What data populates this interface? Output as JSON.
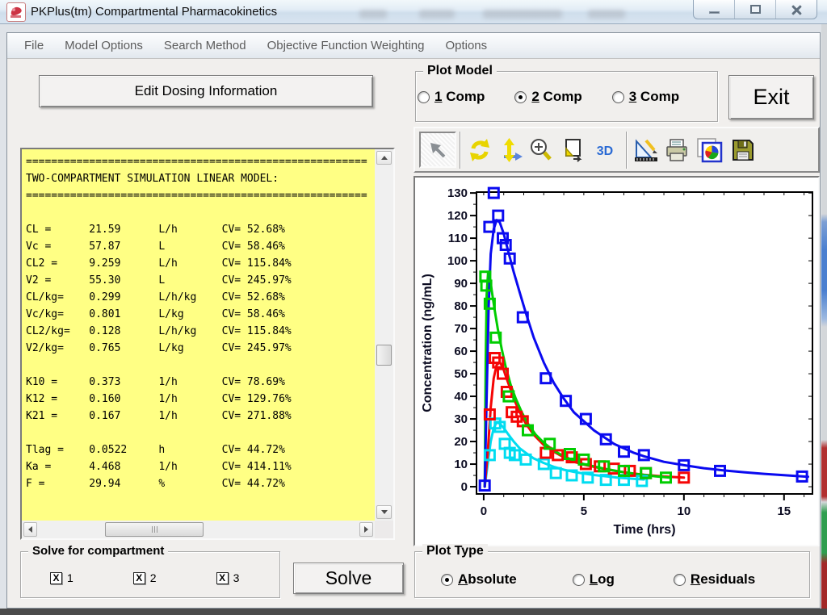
{
  "window": {
    "title": "PKPlus(tm) Compartmental Pharmacokinetics",
    "controls": {
      "minimize": "minimize",
      "maximize": "maximize",
      "close": "close"
    }
  },
  "menu": {
    "items": [
      "File",
      "Model Options",
      "Search Method",
      "Objective Function Weighting",
      "Options"
    ]
  },
  "left_panel": {
    "edit_dosing_button": "Edit Dosing Information",
    "results_lines": [
      "======================================================",
      "TWO-COMPARTMENT SIMULATION LINEAR MODEL:",
      "======================================================",
      "",
      "CL =      21.59      L/h       CV= 52.68%",
      "Vc =      57.87      L         CV= 58.46%",
      "CL2 =     9.259      L/h       CV= 115.84%",
      "V2 =      55.30      L         CV= 245.97%",
      "CL/kg=    0.299      L/h/kg    CV= 52.68%",
      "Vc/kg=    0.801      L/kg      CV= 58.46%",
      "CL2/kg=   0.128      L/h/kg    CV= 115.84%",
      "V2/kg=    0.765      L/kg      CV= 245.97%",
      "",
      "K10 =     0.373      1/h       CV= 78.69%",
      "K12 =     0.160      1/h       CV= 129.76%",
      "K21 =     0.167      1/h       CV= 271.88%",
      "",
      "Tlag =    0.0522     h         CV= 44.72%",
      "Ka =      4.468      1/h       CV= 414.11%",
      "F =       29.94      %         CV= 44.72%"
    ]
  },
  "plot_model": {
    "caption": "Plot Model",
    "options": [
      {
        "label": "1 Comp",
        "underline": 0,
        "selected": false
      },
      {
        "label": "2 Comp",
        "underline": 0,
        "selected": true
      },
      {
        "label": "3 Comp",
        "underline": 0,
        "selected": false
      }
    ]
  },
  "exit_button": "Exit",
  "toolbar": {
    "icon_names": [
      "pointer-icon",
      "refresh-icon",
      "pan-axes-icon",
      "zoom-in-icon",
      "copy-page-icon",
      "3d-view-icon",
      "measure-edit-icon",
      "print-icon",
      "chart-gallery-icon",
      "save-icon"
    ],
    "three_d_label": "3D"
  },
  "solve_group": {
    "caption": "Solve for compartment",
    "checkboxes": [
      {
        "label": "1",
        "checked": true
      },
      {
        "label": "2",
        "checked": true
      },
      {
        "label": "3",
        "checked": true
      }
    ]
  },
  "solve_button": "Solve",
  "plot_type": {
    "caption": "Plot Type",
    "options": [
      {
        "label": "Absolute",
        "underline": 0,
        "selected": true
      },
      {
        "label": "Log",
        "underline": 0,
        "selected": false
      },
      {
        "label": "Residuals",
        "underline": 0,
        "selected": false
      }
    ]
  },
  "chart_data": {
    "type": "line",
    "xlabel": "Time (hrs)",
    "ylabel": "Concentration (ng/mL)",
    "xlim": [
      -0.36,
      16.42
    ],
    "ylim": [
      -3.2,
      130.4
    ],
    "x_major_ticks": [
      0,
      5,
      10,
      15
    ],
    "x_minor_step": 1,
    "y_major_step": 10,
    "y_minor_step": 5,
    "grid": false,
    "legend": "none",
    "series": [
      {
        "name": "comp3-fit",
        "style": "line",
        "color": "#00dcf0",
        "points": [
          [
            0.05,
            0
          ],
          [
            0.2,
            10
          ],
          [
            0.35,
            20
          ],
          [
            0.5,
            26
          ],
          [
            0.65,
            28.5
          ],
          [
            0.8,
            28
          ],
          [
            1,
            26
          ],
          [
            1.2,
            23.5
          ],
          [
            1.5,
            20
          ],
          [
            1.8,
            17
          ],
          [
            2.1,
            15
          ],
          [
            2.5,
            12.5
          ],
          [
            3,
            10.5
          ],
          [
            3.5,
            8.8
          ],
          [
            4,
            7.5
          ],
          [
            4.5,
            6.6
          ],
          [
            5,
            5.8
          ],
          [
            5.5,
            5.2
          ],
          [
            6,
            4.7
          ],
          [
            6.5,
            4.2
          ],
          [
            7,
            3.8
          ],
          [
            7.5,
            3.5
          ],
          [
            8,
            3.2
          ]
        ]
      },
      {
        "name": "comp2-fit",
        "style": "line",
        "color": "#f50505",
        "points": [
          [
            0.05,
            0
          ],
          [
            0.2,
            15
          ],
          [
            0.35,
            35
          ],
          [
            0.5,
            48
          ],
          [
            0.65,
            54
          ],
          [
            0.8,
            55
          ],
          [
            0.95,
            53
          ],
          [
            1.1,
            49
          ],
          [
            1.3,
            44
          ],
          [
            1.5,
            39
          ],
          [
            1.8,
            33
          ],
          [
            2.1,
            28
          ],
          [
            2.5,
            23
          ],
          [
            3,
            18.5
          ],
          [
            3.5,
            15.5
          ],
          [
            4,
            13
          ],
          [
            4.5,
            11
          ],
          [
            5,
            9.8
          ],
          [
            5.5,
            8.8
          ],
          [
            6,
            7.9
          ],
          [
            6.5,
            7.1
          ],
          [
            7,
            6.4
          ],
          [
            7.5,
            5.8
          ],
          [
            8,
            5.3
          ],
          [
            9,
            4.5
          ],
          [
            10,
            4
          ]
        ]
      },
      {
        "name": "comp1-fit",
        "style": "line",
        "color": "#00cd00",
        "points": [
          [
            0.05,
            0
          ],
          [
            0.1,
            55
          ],
          [
            0.15,
            85
          ],
          [
            0.22,
            95
          ],
          [
            0.3,
            93
          ],
          [
            0.4,
            87
          ],
          [
            0.55,
            78
          ],
          [
            0.7,
            70
          ],
          [
            0.9,
            61
          ],
          [
            1.1,
            53
          ],
          [
            1.35,
            45
          ],
          [
            1.6,
            39
          ],
          [
            1.9,
            33
          ],
          [
            2.2,
            28
          ],
          [
            2.6,
            23
          ],
          [
            3,
            19.5
          ],
          [
            3.5,
            16
          ],
          [
            4,
            13.5
          ],
          [
            4.5,
            11.5
          ],
          [
            5,
            10
          ],
          [
            5.5,
            9
          ],
          [
            6,
            8
          ],
          [
            6.5,
            7.2
          ],
          [
            7,
            6.4
          ],
          [
            7.5,
            5.8
          ],
          [
            8,
            5.2
          ],
          [
            8.6,
            4.6
          ],
          [
            9.3,
            4
          ]
        ]
      },
      {
        "name": "central-fit",
        "style": "line",
        "color": "#0a0af0",
        "points": [
          [
            0.05,
            0
          ],
          [
            0.15,
            40
          ],
          [
            0.25,
            80
          ],
          [
            0.35,
            103
          ],
          [
            0.5,
            114
          ],
          [
            0.65,
            118
          ],
          [
            0.8,
            117
          ],
          [
            1,
            112
          ],
          [
            1.2,
            105
          ],
          [
            1.5,
            95
          ],
          [
            1.8,
            86
          ],
          [
            2.1,
            77
          ],
          [
            2.5,
            66
          ],
          [
            3,
            55
          ],
          [
            3.5,
            46
          ],
          [
            4,
            39
          ],
          [
            4.5,
            33
          ],
          [
            5,
            29
          ],
          [
            5.5,
            25
          ],
          [
            6,
            22
          ],
          [
            6.5,
            19
          ],
          [
            7,
            17
          ],
          [
            7.5,
            15
          ],
          [
            8,
            13.5
          ],
          [
            9,
            11
          ],
          [
            10,
            9.5
          ],
          [
            11,
            8.2
          ],
          [
            12,
            7.2
          ],
          [
            13,
            6.4
          ],
          [
            14,
            5.7
          ],
          [
            15,
            5.1
          ],
          [
            16.2,
            4.4
          ]
        ]
      },
      {
        "name": "comp3-observed",
        "style": "markers",
        "color": "#00dcf0",
        "points": [
          [
            0.3,
            14
          ],
          [
            0.58,
            28
          ],
          [
            0.8,
            26.5
          ],
          [
            1.05,
            19
          ],
          [
            1.3,
            15
          ],
          [
            1.55,
            14
          ],
          [
            2.1,
            12
          ],
          [
            3,
            10
          ],
          [
            3.6,
            6
          ],
          [
            4.4,
            5
          ],
          [
            5.2,
            4
          ],
          [
            6.1,
            3
          ],
          [
            7,
            3
          ],
          [
            7.9,
            2.5
          ]
        ]
      },
      {
        "name": "comp2-observed",
        "style": "markers",
        "color": "#f50505",
        "points": [
          [
            0.3,
            32
          ],
          [
            0.55,
            57
          ],
          [
            0.72,
            55
          ],
          [
            0.95,
            50
          ],
          [
            1.15,
            42
          ],
          [
            1.4,
            33
          ],
          [
            1.65,
            31
          ],
          [
            1.95,
            29
          ],
          [
            3.1,
            15
          ],
          [
            3.7,
            14
          ],
          [
            4.4,
            13
          ],
          [
            5.1,
            10
          ],
          [
            5.8,
            9
          ],
          [
            6.5,
            8
          ],
          [
            7.3,
            7
          ],
          [
            8.1,
            6
          ],
          [
            10,
            4
          ]
        ]
      },
      {
        "name": "comp1-observed",
        "style": "markers",
        "color": "#00cd00",
        "points": [
          [
            0.08,
            93
          ],
          [
            0.13,
            89
          ],
          [
            0.3,
            81
          ],
          [
            0.6,
            66
          ],
          [
            1.25,
            40
          ],
          [
            2.2,
            25
          ],
          [
            3.3,
            19
          ],
          [
            4.3,
            14.5
          ],
          [
            5,
            12
          ],
          [
            6,
            9
          ],
          [
            7,
            7
          ],
          [
            8.1,
            6
          ],
          [
            9.1,
            4
          ]
        ]
      },
      {
        "name": "central-observed",
        "style": "markers",
        "color": "#0a0af0",
        "points": [
          [
            0.05,
            0.5
          ],
          [
            0.28,
            115
          ],
          [
            0.5,
            130
          ],
          [
            0.72,
            120
          ],
          [
            0.95,
            110
          ],
          [
            1.1,
            107
          ],
          [
            1.3,
            101
          ],
          [
            1.95,
            75
          ],
          [
            3.1,
            48
          ],
          [
            4.1,
            38
          ],
          [
            5.1,
            30
          ],
          [
            6.1,
            21
          ],
          [
            7,
            15.5
          ],
          [
            8,
            14
          ],
          [
            10,
            9.5
          ],
          [
            11.8,
            7
          ],
          [
            15.9,
            4.5
          ]
        ]
      }
    ]
  }
}
